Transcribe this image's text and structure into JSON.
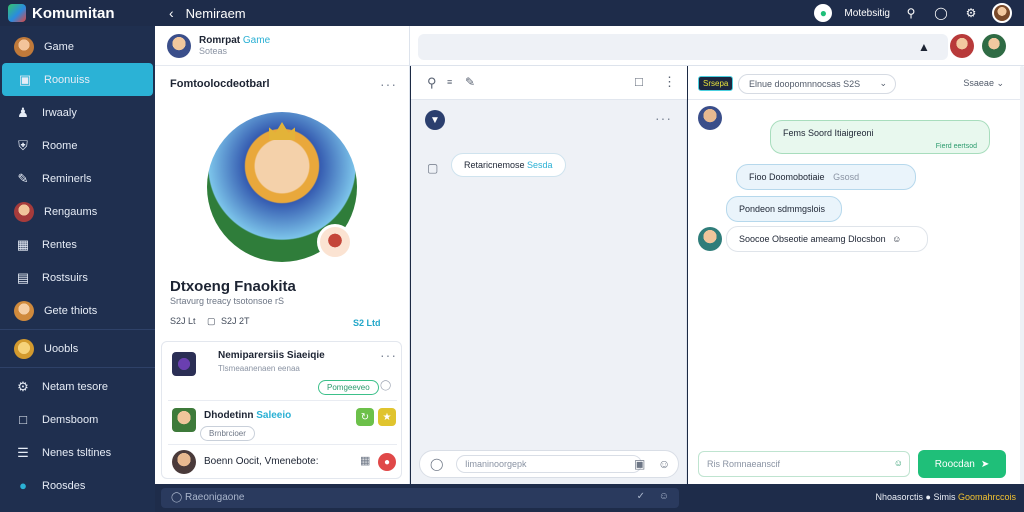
{
  "app": {
    "name": "Komumitan",
    "page_title": "Nemiraem",
    "status_text": "Motebsitig"
  },
  "sidebar": {
    "items": [
      {
        "label": "Game",
        "icon": "user-avatar"
      },
      {
        "label": "Roonuiss",
        "icon": "chat-bubbles-icon",
        "active": true
      },
      {
        "label": "Irwaaly",
        "icon": "person-icon"
      },
      {
        "label": "Roome",
        "icon": "shield-icon"
      },
      {
        "label": "Reminerls",
        "icon": "pencil-icon"
      },
      {
        "label": "Rengaums",
        "icon": "avatar"
      },
      {
        "label": "Rentes",
        "icon": "grid-icon"
      },
      {
        "label": "Rostsuirs",
        "icon": "calendar-icon"
      },
      {
        "label": "Gete thiots",
        "icon": "avatar"
      },
      {
        "label": "Uoobls",
        "icon": "avatar"
      },
      {
        "label": "Netam tesore",
        "icon": "settings-icon"
      },
      {
        "label": "Demsboom",
        "icon": "inbox-icon"
      },
      {
        "label": "Nenes tsltines",
        "icon": "list-icon"
      },
      {
        "label": "Roosdes",
        "icon": "help-icon"
      }
    ]
  },
  "left_panel": {
    "header_title": "Romrpat",
    "header_title_accent": "Game",
    "header_sub": "Soteas",
    "section_title": "Fomtoolocdeotbarl",
    "hero_name": "Dtxoeng Fnaokita",
    "hero_sub": "Srtavurg treacy tsotonsoe rS",
    "stat_a": "S2J Lt",
    "stat_b": "S2J 2T",
    "stat_accent": "S2 Ltd",
    "cards": [
      {
        "title": "Nemiparersiis Siaeiqie",
        "sub": "Tlsmeaanenaen eenaa",
        "pill": "Pomgeeveo"
      },
      {
        "title": "Dhodetinn",
        "title_accent": "Saleeio",
        "pill": "Brnbrcioer"
      },
      {
        "title": "Boenn Oocit, Vmenebote:"
      }
    ]
  },
  "middle_panel": {
    "bubble_text": "Retaricnemose",
    "bubble_accent": "Sesda",
    "compose_placeholder": "Iimaninoorgepk"
  },
  "right_panel": {
    "tag": "Srsepa",
    "select_text": "Elnue doopomnnocsas S2S",
    "filter": "Ssaeae",
    "messages": [
      {
        "text": "Fems Soord Itiaigreoni",
        "sub": "Fierd eertsod",
        "style": "green"
      },
      {
        "text": "Fioo Doomobotiaie",
        "extra": "Gsosd",
        "style": "blue"
      },
      {
        "text": "Pondeon sdmmgslois",
        "style": "blue"
      },
      {
        "text": "Soocoe Obseotie ameamg Dlocsbon",
        "style": "white"
      }
    ],
    "compose_placeholder": "Ris Romnaeanscif",
    "send_label": "Roocdan"
  },
  "bottom_bar": {
    "field": "Raeonigaone",
    "right_text": "Nhoasorctis",
    "right_mid": "Simis",
    "right_accent": "Goomahrccois"
  },
  "colors": {
    "topbar": "#1e2c4a",
    "sidebar": "#1f2f4f",
    "accent": "#2bb2d6",
    "send": "#1fbf79"
  }
}
